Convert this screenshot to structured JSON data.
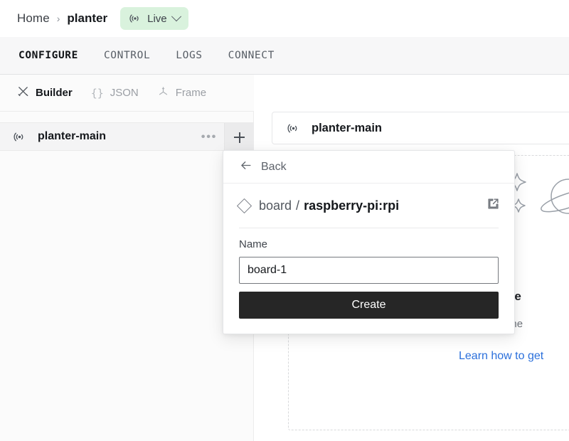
{
  "breadcrumb": {
    "home": "Home",
    "separator": "›",
    "current": "planter",
    "status_badge": {
      "label": "Live",
      "color": "#d9f2dd"
    }
  },
  "nav_tabs": [
    {
      "label": "CONFIGURE",
      "active": true
    },
    {
      "label": "CONTROL",
      "active": false
    },
    {
      "label": "LOGS",
      "active": false
    },
    {
      "label": "CONNECT",
      "active": false
    }
  ],
  "sub_tabs": [
    {
      "label": "Builder",
      "icon": "tools-icon",
      "active": true
    },
    {
      "label": "JSON",
      "icon": "braces-icon",
      "glyph": "{}",
      "active": false
    },
    {
      "label": "Frame",
      "icon": "frame-axes-icon",
      "active": false
    }
  ],
  "sidebar": {
    "row": {
      "name": "planter-main",
      "icon": "radio-signal-icon",
      "menu_label": "•••",
      "add_label": "+"
    }
  },
  "main": {
    "card_title": "planter-main",
    "card_icon": "radio-signal-icon",
    "empty_state": {
      "title": "is machine",
      "subtitle": "your machine",
      "link": "Learn how to get"
    }
  },
  "popover": {
    "back_label": "Back",
    "back_icon": "arrow-left-icon",
    "type_icon": "diamond-icon",
    "namespace": "board",
    "slash": "/",
    "model": "raspberry-pi:rpi",
    "external_link_icon": "external-link-icon",
    "name_label": "Name",
    "name_value": "board-1",
    "name_placeholder": "Name",
    "create_label": "Create"
  },
  "colors": {
    "accent_link": "#2a6fdb",
    "badge_green": "#d9f2dd",
    "button_dark": "#262626"
  }
}
